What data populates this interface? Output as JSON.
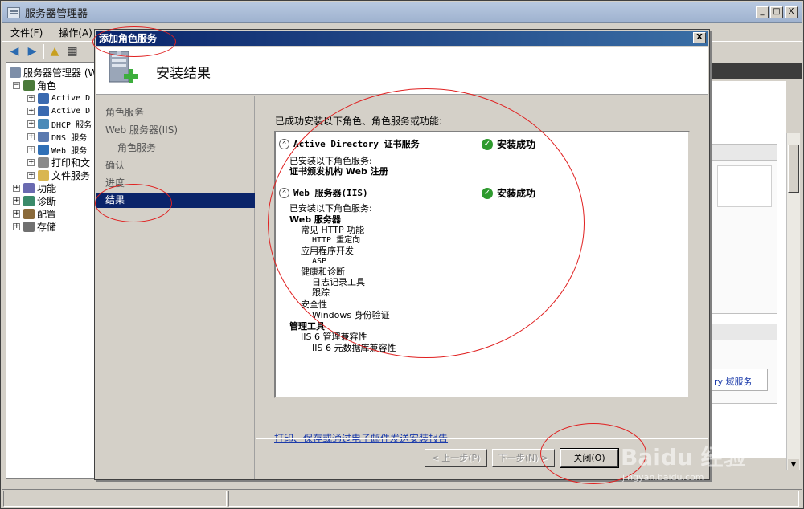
{
  "main_window": {
    "title": "服务器管理器",
    "controls": {
      "minimize": "_",
      "restore": "□",
      "close": "X"
    },
    "menu": [
      "文件(F)",
      "操作(A)"
    ],
    "toolbar_icons": [
      "back-arrow-icon",
      "forward-arrow-icon",
      "up-folder-icon",
      "list-view-icon"
    ]
  },
  "tree": {
    "items": [
      {
        "label": "服务器管理器 (W",
        "exp": ""
      },
      {
        "label": "角色",
        "exp": "−"
      },
      {
        "label": "Active D",
        "exp": "+"
      },
      {
        "label": "Active D",
        "exp": "+"
      },
      {
        "label": "DHCP 服务",
        "exp": "+"
      },
      {
        "label": "DNS 服务",
        "exp": "+"
      },
      {
        "label": "Web 服务",
        "exp": "+"
      },
      {
        "label": "打印和文",
        "exp": "+"
      },
      {
        "label": "文件服务",
        "exp": "+"
      },
      {
        "label": "功能",
        "exp": "+"
      },
      {
        "label": "诊断",
        "exp": "+"
      },
      {
        "label": "配置",
        "exp": "+"
      },
      {
        "label": "存储",
        "exp": "+"
      }
    ]
  },
  "right_pane": {
    "link": "ry 域服务"
  },
  "dialog": {
    "title": "添加角色服务",
    "close": "X",
    "header_title": "安装结果",
    "nav": [
      {
        "label": "角色服务"
      },
      {
        "label": "Web 服务器(IIS)"
      },
      {
        "label": "角色服务"
      },
      {
        "label": "确认"
      },
      {
        "label": "进度"
      },
      {
        "label": "结果"
      }
    ],
    "content_title": "已成功安装以下角色、角色服务或功能:",
    "results": [
      {
        "collapse": "^",
        "name": "Active Directory 证书服务",
        "status": "安装成功",
        "lines": [
          {
            "text": "已安装以下角色服务:"
          },
          {
            "text": "证书颁发机构 Web 注册"
          }
        ]
      },
      {
        "collapse": "^",
        "name": "Web 服务器(IIS)",
        "status": "安装成功",
        "lines": [
          {
            "text": "已安装以下角色服务:"
          },
          {
            "text": "Web 服务器"
          },
          {
            "text": "常见 HTTP 功能"
          },
          {
            "text": "HTTP 重定向"
          },
          {
            "text": "应用程序开发"
          },
          {
            "text": "ASP"
          },
          {
            "text": "健康和诊断"
          },
          {
            "text": "日志记录工具"
          },
          {
            "text": "跟踪"
          },
          {
            "text": "安全性"
          },
          {
            "text": "Windows 身份验证"
          },
          {
            "text": "管理工具"
          },
          {
            "text": "IIS 6 管理兼容性"
          },
          {
            "text": "IIS 6 元数据库兼容性"
          }
        ]
      }
    ],
    "ok_icon": "✓",
    "report_link": "打印、保存或通过电子邮件发送安装报告",
    "buttons": {
      "prev": "< 上一步(P)",
      "next": "下一步(N) >",
      "close": "关闭(O)"
    }
  },
  "watermark": {
    "logo": "Baidu 经验",
    "url": "jingyan.baidu.com"
  }
}
